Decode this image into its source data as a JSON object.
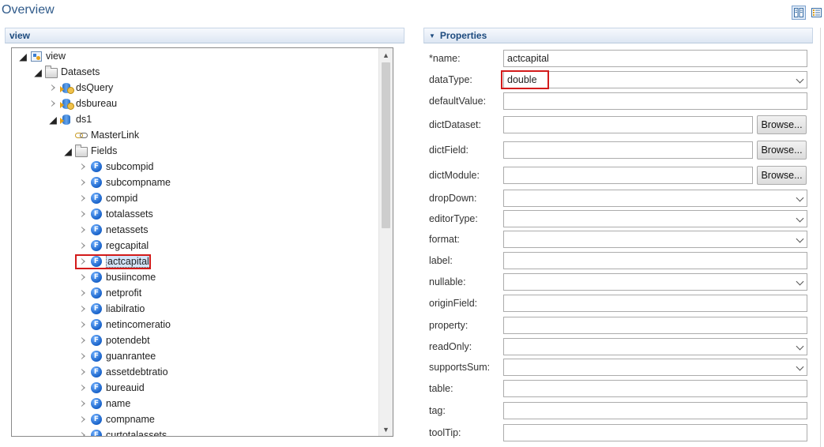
{
  "header": {
    "title": "Overview",
    "layout_icon": "grid-layout-icon",
    "list_icon": "list-layout-icon"
  },
  "view_section": {
    "title": "view"
  },
  "tree": {
    "root": "view",
    "datasets": "Datasets",
    "dsQuery": "dsQuery",
    "dsbureau": "dsbureau",
    "ds1": "ds1",
    "masterlink": "MasterLink",
    "fields_folder": "Fields",
    "fields": [
      "subcompid",
      "subcompname",
      "compid",
      "totalassets",
      "netassets",
      "regcapital",
      "actcapital",
      "busiincome",
      "netprofit",
      "liabilratio",
      "netincomeratio",
      "potendebt",
      "guanrantee",
      "assetdebtratio",
      "bureauid",
      "name",
      "compname",
      "curtotalassets"
    ],
    "selected_field": "actcapital"
  },
  "properties": {
    "title": "Properties",
    "browse_label": "Browse...",
    "rows": [
      {
        "label": "*name:",
        "kind": "input",
        "value": "actcapital"
      },
      {
        "label": "dataType:",
        "kind": "select",
        "value": "double"
      },
      {
        "label": "defaultValue:",
        "kind": "input",
        "value": ""
      },
      {
        "label": "dictDataset:",
        "kind": "browse",
        "value": ""
      },
      {
        "label": "dictField:",
        "kind": "browse",
        "value": ""
      },
      {
        "label": "dictModule:",
        "kind": "browse",
        "value": ""
      },
      {
        "label": "dropDown:",
        "kind": "select",
        "value": ""
      },
      {
        "label": "editorType:",
        "kind": "select",
        "value": ""
      },
      {
        "label": "format:",
        "kind": "select",
        "value": ""
      },
      {
        "label": "label:",
        "kind": "input",
        "value": ""
      },
      {
        "label": "nullable:",
        "kind": "select",
        "value": ""
      },
      {
        "label": "originField:",
        "kind": "input",
        "value": ""
      },
      {
        "label": "property:",
        "kind": "input",
        "value": ""
      },
      {
        "label": "readOnly:",
        "kind": "select",
        "value": ""
      },
      {
        "label": "supportsSum:",
        "kind": "select",
        "value": ""
      },
      {
        "label": "table:",
        "kind": "input",
        "value": ""
      },
      {
        "label": "tag:",
        "kind": "input",
        "value": ""
      },
      {
        "label": "toolTip:",
        "kind": "input",
        "value": ""
      }
    ]
  },
  "colors": {
    "title": "#2f5a8a",
    "section_header": "#1c4a7e",
    "highlight_box": "#d31b1b",
    "field_icon": "#1a63c9"
  }
}
